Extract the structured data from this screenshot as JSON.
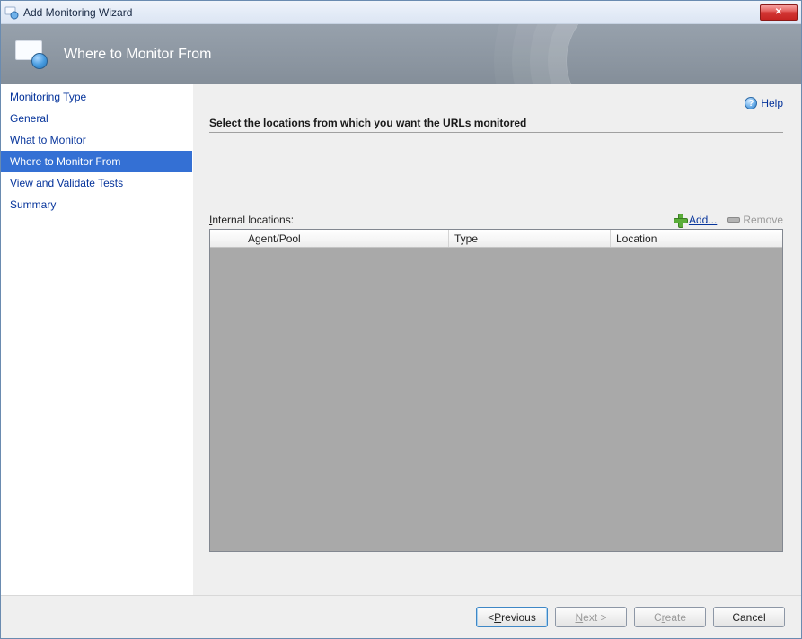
{
  "window": {
    "title": "Add Monitoring Wizard"
  },
  "banner": {
    "title": "Where to Monitor From"
  },
  "sidebar": {
    "items": [
      {
        "label": "Monitoring Type",
        "active": false
      },
      {
        "label": "General",
        "active": false
      },
      {
        "label": "What to Monitor",
        "active": false
      },
      {
        "label": "Where to Monitor From",
        "active": true
      },
      {
        "label": "View and Validate Tests",
        "active": false
      },
      {
        "label": "Summary",
        "active": false
      }
    ]
  },
  "content": {
    "helpLabel": "Help",
    "instruction": "Select the locations from which you want the URLs monitored",
    "internalLabelPrefix": "I",
    "internalLabelRest": "nternal locations:",
    "addPrefix": "A",
    "addRest": "dd...",
    "removeLabel": "Remove",
    "columns": {
      "agent": "Agent/Pool",
      "type": "Type",
      "location": "Location"
    },
    "rows": []
  },
  "footer": {
    "prevPrefix": "< ",
    "prevMnemonic": "P",
    "prevRest": "revious",
    "nextMnemonic": "N",
    "nextRest": "ext >",
    "createPrefix": "C",
    "createMnemonic": "r",
    "createRest": "eate",
    "cancelLabel": "Cancel"
  }
}
